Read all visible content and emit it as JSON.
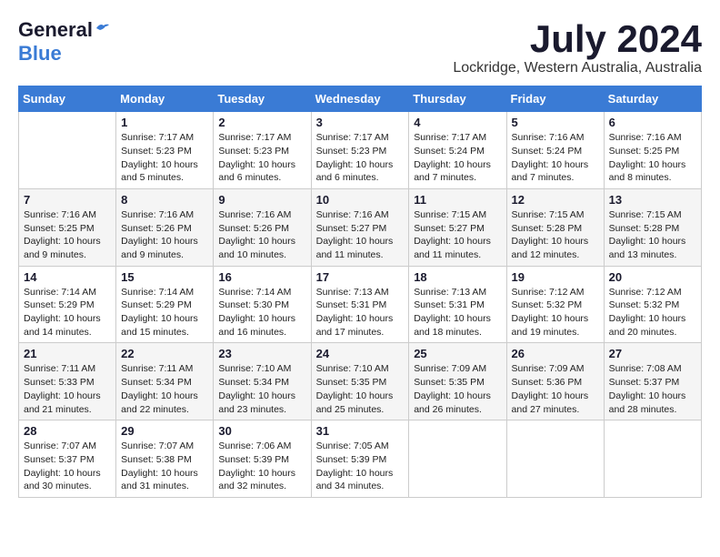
{
  "logo": {
    "line1": "General",
    "line2": "Blue"
  },
  "title": "July 2024",
  "location": "Lockridge, Western Australia, Australia",
  "weekdays": [
    "Sunday",
    "Monday",
    "Tuesday",
    "Wednesday",
    "Thursday",
    "Friday",
    "Saturday"
  ],
  "weeks": [
    [
      {
        "day": "",
        "info": ""
      },
      {
        "day": "1",
        "info": "Sunrise: 7:17 AM\nSunset: 5:23 PM\nDaylight: 10 hours\nand 5 minutes."
      },
      {
        "day": "2",
        "info": "Sunrise: 7:17 AM\nSunset: 5:23 PM\nDaylight: 10 hours\nand 6 minutes."
      },
      {
        "day": "3",
        "info": "Sunrise: 7:17 AM\nSunset: 5:23 PM\nDaylight: 10 hours\nand 6 minutes."
      },
      {
        "day": "4",
        "info": "Sunrise: 7:17 AM\nSunset: 5:24 PM\nDaylight: 10 hours\nand 7 minutes."
      },
      {
        "day": "5",
        "info": "Sunrise: 7:16 AM\nSunset: 5:24 PM\nDaylight: 10 hours\nand 7 minutes."
      },
      {
        "day": "6",
        "info": "Sunrise: 7:16 AM\nSunset: 5:25 PM\nDaylight: 10 hours\nand 8 minutes."
      }
    ],
    [
      {
        "day": "7",
        "info": "Sunrise: 7:16 AM\nSunset: 5:25 PM\nDaylight: 10 hours\nand 9 minutes."
      },
      {
        "day": "8",
        "info": "Sunrise: 7:16 AM\nSunset: 5:26 PM\nDaylight: 10 hours\nand 9 minutes."
      },
      {
        "day": "9",
        "info": "Sunrise: 7:16 AM\nSunset: 5:26 PM\nDaylight: 10 hours\nand 10 minutes."
      },
      {
        "day": "10",
        "info": "Sunrise: 7:16 AM\nSunset: 5:27 PM\nDaylight: 10 hours\nand 11 minutes."
      },
      {
        "day": "11",
        "info": "Sunrise: 7:15 AM\nSunset: 5:27 PM\nDaylight: 10 hours\nand 11 minutes."
      },
      {
        "day": "12",
        "info": "Sunrise: 7:15 AM\nSunset: 5:28 PM\nDaylight: 10 hours\nand 12 minutes."
      },
      {
        "day": "13",
        "info": "Sunrise: 7:15 AM\nSunset: 5:28 PM\nDaylight: 10 hours\nand 13 minutes."
      }
    ],
    [
      {
        "day": "14",
        "info": "Sunrise: 7:14 AM\nSunset: 5:29 PM\nDaylight: 10 hours\nand 14 minutes."
      },
      {
        "day": "15",
        "info": "Sunrise: 7:14 AM\nSunset: 5:29 PM\nDaylight: 10 hours\nand 15 minutes."
      },
      {
        "day": "16",
        "info": "Sunrise: 7:14 AM\nSunset: 5:30 PM\nDaylight: 10 hours\nand 16 minutes."
      },
      {
        "day": "17",
        "info": "Sunrise: 7:13 AM\nSunset: 5:31 PM\nDaylight: 10 hours\nand 17 minutes."
      },
      {
        "day": "18",
        "info": "Sunrise: 7:13 AM\nSunset: 5:31 PM\nDaylight: 10 hours\nand 18 minutes."
      },
      {
        "day": "19",
        "info": "Sunrise: 7:12 AM\nSunset: 5:32 PM\nDaylight: 10 hours\nand 19 minutes."
      },
      {
        "day": "20",
        "info": "Sunrise: 7:12 AM\nSunset: 5:32 PM\nDaylight: 10 hours\nand 20 minutes."
      }
    ],
    [
      {
        "day": "21",
        "info": "Sunrise: 7:11 AM\nSunset: 5:33 PM\nDaylight: 10 hours\nand 21 minutes."
      },
      {
        "day": "22",
        "info": "Sunrise: 7:11 AM\nSunset: 5:34 PM\nDaylight: 10 hours\nand 22 minutes."
      },
      {
        "day": "23",
        "info": "Sunrise: 7:10 AM\nSunset: 5:34 PM\nDaylight: 10 hours\nand 23 minutes."
      },
      {
        "day": "24",
        "info": "Sunrise: 7:10 AM\nSunset: 5:35 PM\nDaylight: 10 hours\nand 25 minutes."
      },
      {
        "day": "25",
        "info": "Sunrise: 7:09 AM\nSunset: 5:35 PM\nDaylight: 10 hours\nand 26 minutes."
      },
      {
        "day": "26",
        "info": "Sunrise: 7:09 AM\nSunset: 5:36 PM\nDaylight: 10 hours\nand 27 minutes."
      },
      {
        "day": "27",
        "info": "Sunrise: 7:08 AM\nSunset: 5:37 PM\nDaylight: 10 hours\nand 28 minutes."
      }
    ],
    [
      {
        "day": "28",
        "info": "Sunrise: 7:07 AM\nSunset: 5:37 PM\nDaylight: 10 hours\nand 30 minutes."
      },
      {
        "day": "29",
        "info": "Sunrise: 7:07 AM\nSunset: 5:38 PM\nDaylight: 10 hours\nand 31 minutes."
      },
      {
        "day": "30",
        "info": "Sunrise: 7:06 AM\nSunset: 5:39 PM\nDaylight: 10 hours\nand 32 minutes."
      },
      {
        "day": "31",
        "info": "Sunrise: 7:05 AM\nSunset: 5:39 PM\nDaylight: 10 hours\nand 34 minutes."
      },
      {
        "day": "",
        "info": ""
      },
      {
        "day": "",
        "info": ""
      },
      {
        "day": "",
        "info": ""
      }
    ]
  ]
}
